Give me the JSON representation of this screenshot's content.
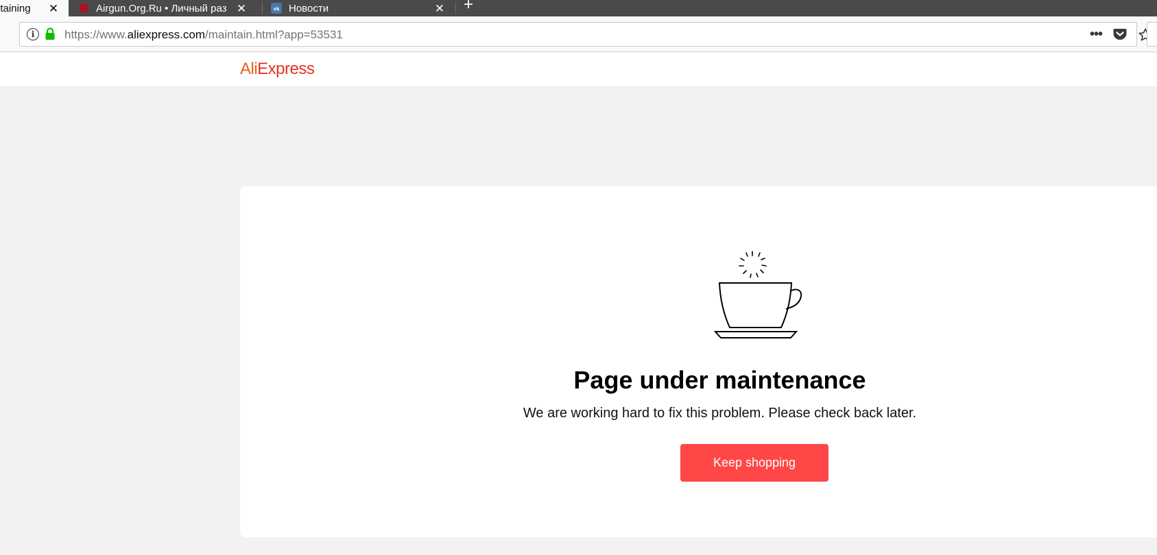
{
  "browser": {
    "tabs": [
      {
        "label": "ntaining",
        "active": true
      },
      {
        "label": "Airgun.Org.Ru • Личный разде",
        "active": false
      },
      {
        "label": "Новости",
        "active": false
      }
    ],
    "url": {
      "prefix": "https://www.",
      "domain": "aliexpress.com",
      "path": "/maintain.html?app=53531"
    },
    "url_actions": {
      "more_icon": "•••"
    }
  },
  "site": {
    "logo_ali": "Ali",
    "logo_express": "Express",
    "logo_colors": {
      "ali": "#e5611a",
      "express": "#e43225"
    }
  },
  "maintenance": {
    "title": "Page under maintenance",
    "subtitle": "We are working hard to fix this problem. Please check back later.",
    "button_label": "Keep shopping",
    "accent_color": "#ff4747"
  }
}
